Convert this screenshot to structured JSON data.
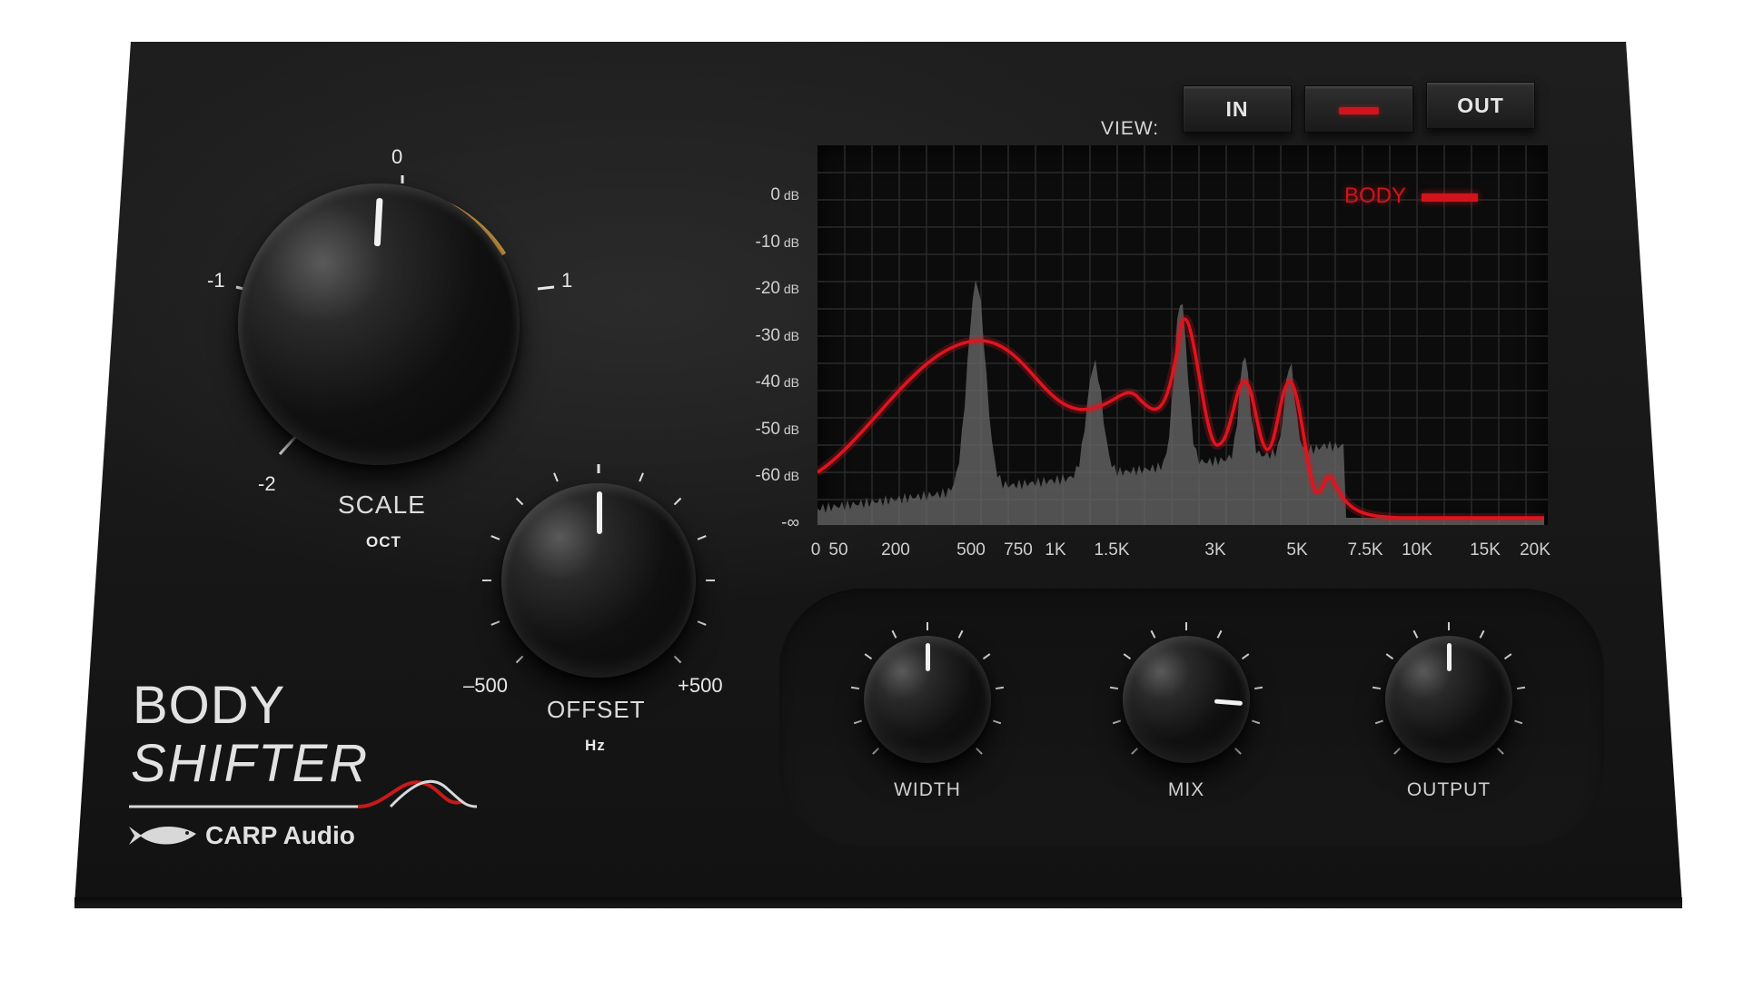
{
  "plugin": {
    "title_line1": "BODY",
    "title_line2": "SHIFTER",
    "brand": "CARP Audio"
  },
  "view": {
    "label": "VIEW:",
    "buttons": [
      "IN",
      "",
      "OUT"
    ],
    "accent": "#e0141e"
  },
  "scale_knob": {
    "title": "SCALE",
    "unit": "OCT",
    "ticks": [
      "0",
      "1",
      "-1",
      "-2"
    ],
    "value": 0
  },
  "offset_knob": {
    "title": "OFFSET",
    "unit": "Hz",
    "min_label": "–500",
    "max_label": "+500",
    "value": 0
  },
  "small_knobs": [
    {
      "title": "WIDTH",
      "value": 0.5
    },
    {
      "title": "MIX",
      "value": 0.85
    },
    {
      "title": "OUTPUT",
      "value": 0.5
    }
  ],
  "graph": {
    "legend": "BODY",
    "db_labels": [
      "0",
      "-10",
      "-20",
      "-30",
      "-40",
      "-50",
      "-60",
      "-∞"
    ],
    "db_unit": "dB",
    "freq_labels": [
      "0",
      "50",
      "200",
      "500",
      "750",
      "1K",
      "1.5K",
      "3K",
      "5K",
      "7.5K",
      "10K",
      "15K",
      "20K"
    ],
    "colors": {
      "body_line": "#e0141e",
      "input_fill": "#6a6a6a",
      "grid": "#2a2a2a"
    }
  },
  "colors": {
    "scale_positive_arc": "#e3a84a",
    "scale_negative_arc": "#d42020"
  }
}
